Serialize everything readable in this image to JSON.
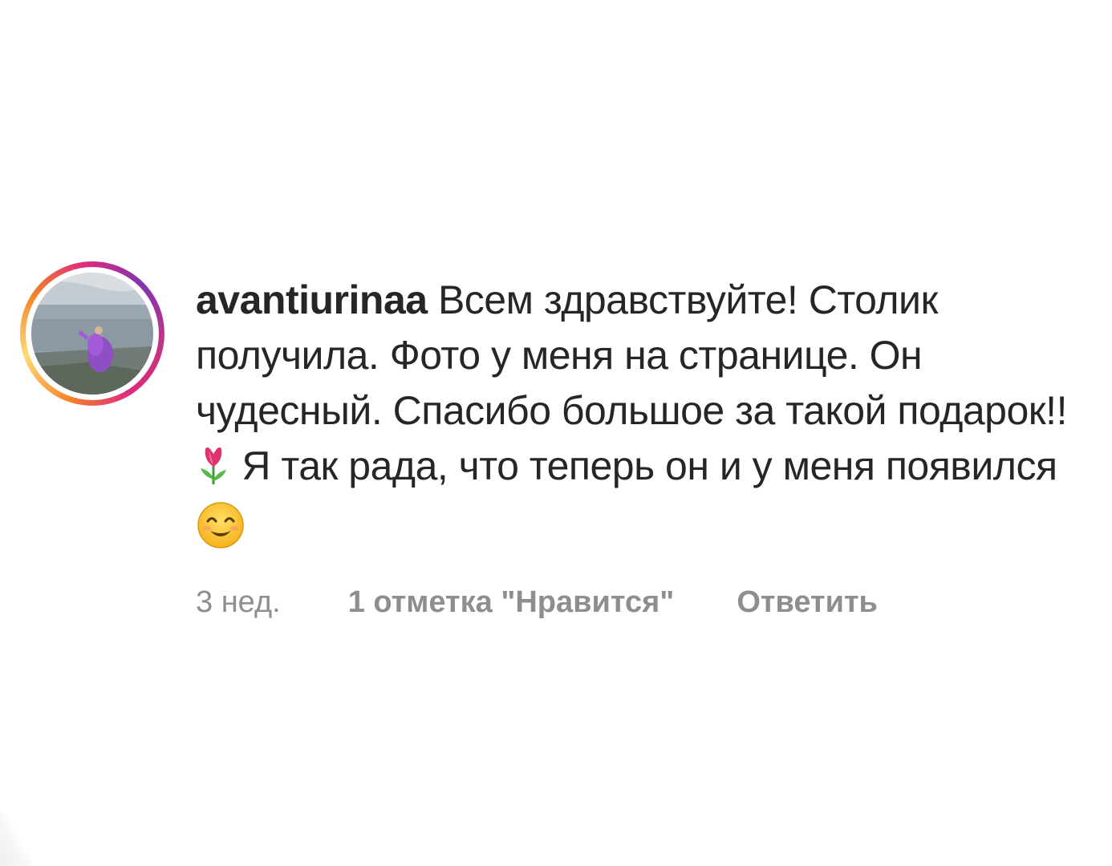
{
  "comment": {
    "username": "avantiurinaa",
    "text_part1": " Всем здравствуйте! Столик получила. Фото у меня на странице. Он чудесный. Спасибо большое за такой подарок!! ",
    "text_part2": " Я так рада, что теперь он  и у меня появился ",
    "icons": [
      "tulip-emoji",
      "smiling-face-emoji"
    ],
    "time": "3 нед.",
    "likes": "1 отметка \"Нравится\"",
    "reply": "Ответить"
  },
  "colors": {
    "text": "#262626",
    "meta": "#8e8e8e",
    "story_ring": [
      "#f58529",
      "#dd2a7b",
      "#8134af"
    ]
  }
}
